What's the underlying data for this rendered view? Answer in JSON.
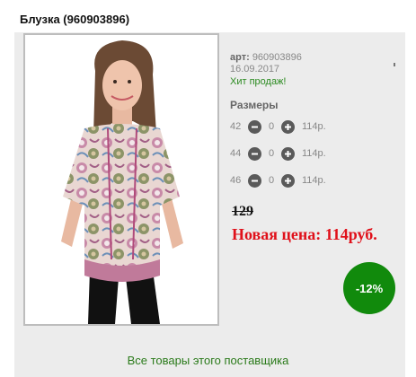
{
  "product": {
    "title": "Блузка (960903896)",
    "image_alt": "woman-in-blouse-photo"
  },
  "info": {
    "article_label": "арт:",
    "article_value": "960903896",
    "date": "16.09.2017",
    "hit": "Хит продаж!",
    "sizes_title": "Размеры"
  },
  "sizes": [
    {
      "size": "42",
      "qty": "0",
      "price": "114р."
    },
    {
      "size": "44",
      "qty": "0",
      "price": "114р."
    },
    {
      "size": "46",
      "qty": "0",
      "price": "114р."
    }
  ],
  "pricing": {
    "old_price": "129",
    "new_price": "Новая цена: 114руб.",
    "discount": "-12%"
  },
  "footer": {
    "supplier_link": "Все товары этого поставщика"
  },
  "colors": {
    "accent_green": "#118a0c",
    "price_red": "#e0101a",
    "link_green": "#2a7a1a"
  }
}
